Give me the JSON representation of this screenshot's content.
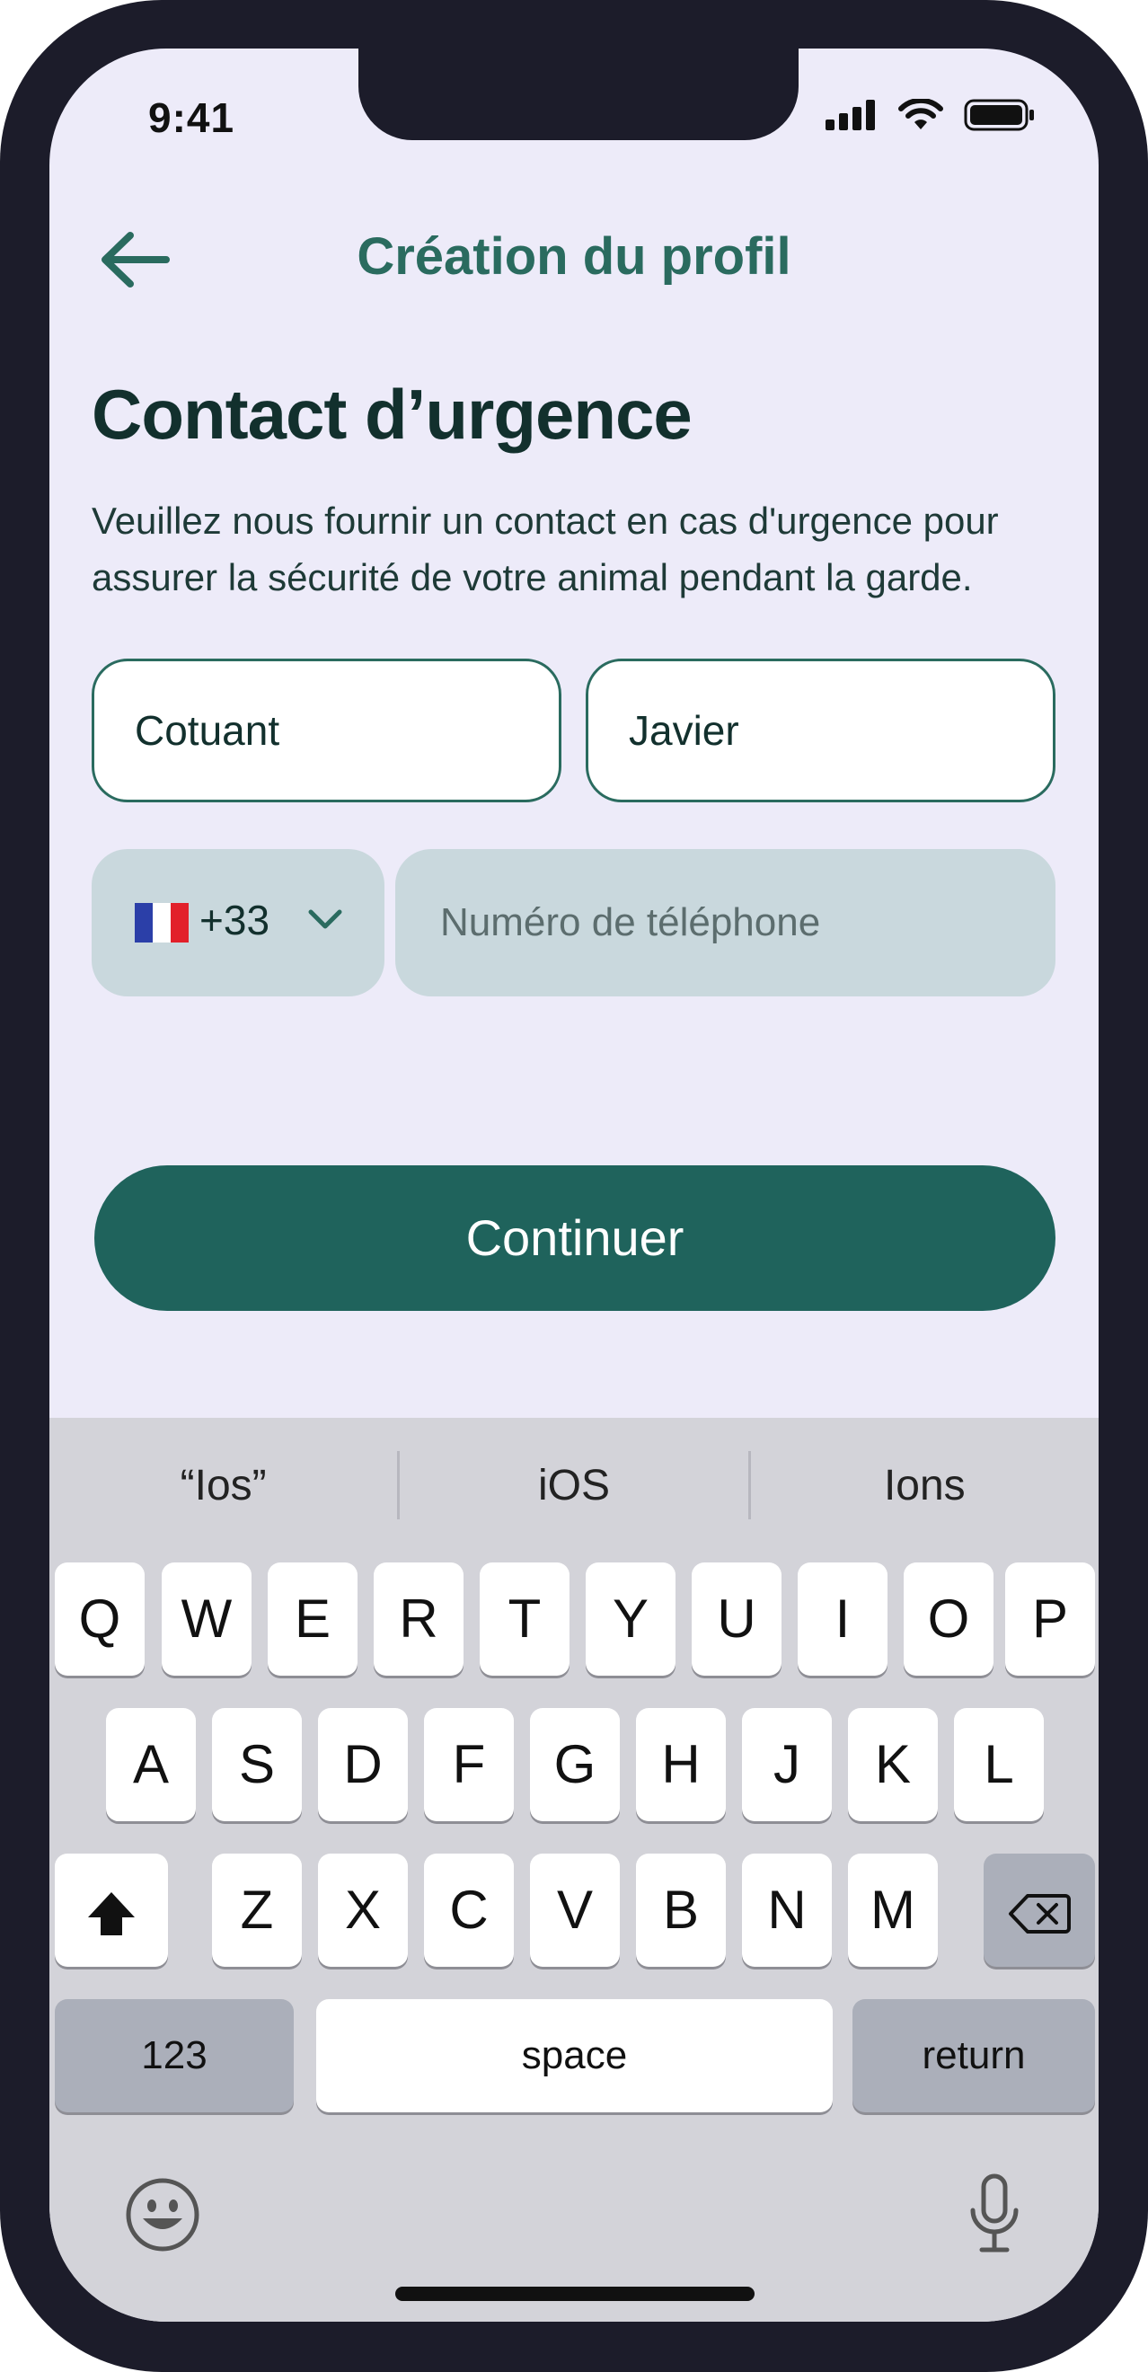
{
  "status": {
    "time": "9:41"
  },
  "header": {
    "title": "Création du profil"
  },
  "content": {
    "heading": "Contact d’urgence",
    "description": "Veuillez nous fournir un contact en cas d'urgence pour assurer la sécurité de votre animal pendant la garde.",
    "last_name_value": "Cotuant",
    "first_name_value": "Javier",
    "country_code": "+33",
    "phone_placeholder": "Numéro de téléphone",
    "continue_label": "Continuer"
  },
  "keyboard": {
    "suggestions": [
      "“Ios”",
      "iOS",
      "Ions"
    ],
    "row1": [
      "Q",
      "W",
      "E",
      "R",
      "T",
      "Y",
      "U",
      "I",
      "O",
      "P"
    ],
    "row2": [
      "A",
      "S",
      "D",
      "F",
      "G",
      "H",
      "J",
      "K",
      "L"
    ],
    "row3": [
      "Z",
      "X",
      "C",
      "V",
      "B",
      "N",
      "M"
    ],
    "numbers_label": "123",
    "space_label": "space",
    "return_label": "return"
  },
  "colors": {
    "accent": "#1f635c",
    "background": "#edebf9",
    "field_fill": "#c9d8dd"
  },
  "icons": [
    "back-arrow-icon",
    "signal-icon",
    "wifi-icon",
    "battery-icon",
    "france-flag-icon",
    "chevron-down-icon",
    "shift-icon",
    "delete-icon",
    "emoji-icon",
    "microphone-icon"
  ]
}
